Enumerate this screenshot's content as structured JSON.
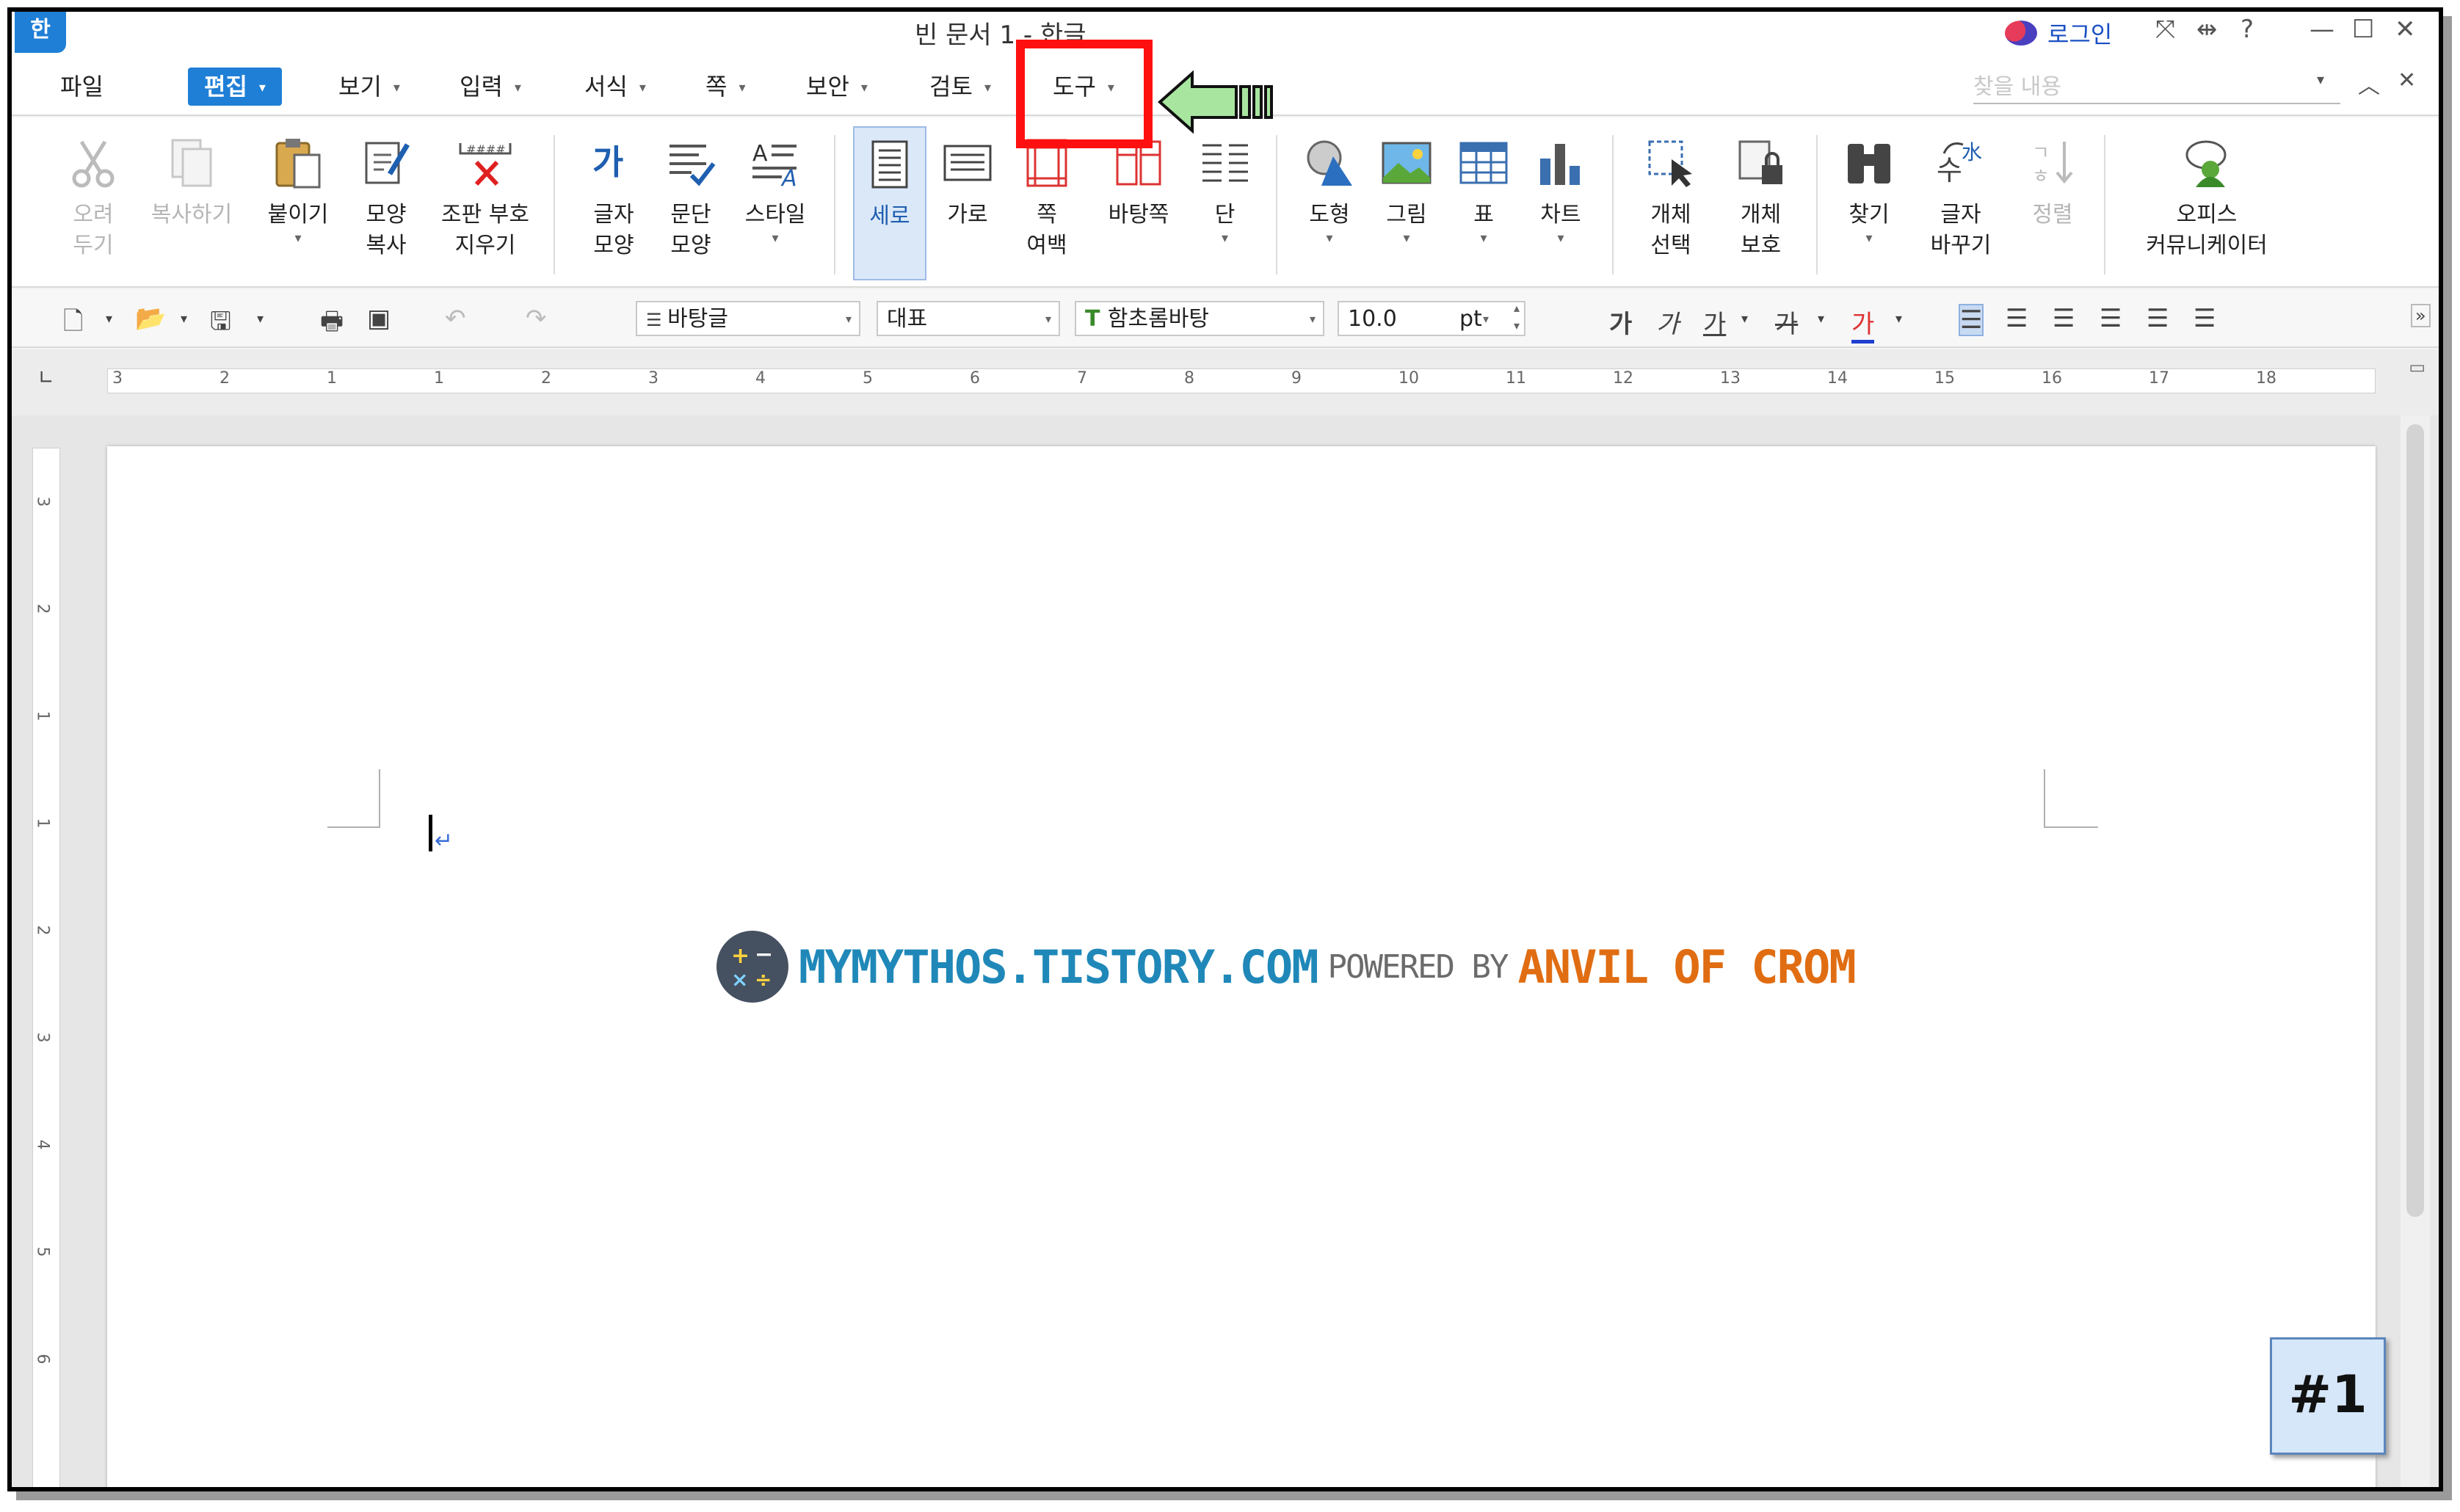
{
  "window": {
    "title": "빈 문서 1 - 한글",
    "app_icon": "한",
    "login_label": "로그인",
    "icons": [
      "fullscreen-icon",
      "pin-icon",
      "help-icon",
      "minimize-icon",
      "maximize-icon",
      "close-icon"
    ]
  },
  "menu": {
    "items": [
      {
        "label": "파일"
      },
      {
        "label": "편집",
        "active": true
      },
      {
        "label": "보기"
      },
      {
        "label": "입력"
      },
      {
        "label": "서식"
      },
      {
        "label": "쪽"
      },
      {
        "label": "보안"
      },
      {
        "label": "검토"
      },
      {
        "label": "도구",
        "highlighted": true
      }
    ],
    "find_placeholder": "찾을 내용"
  },
  "ribbon": {
    "buttons": [
      {
        "label": "오려\n두기",
        "icon": "scissors-icon",
        "disabled": true
      },
      {
        "label": "복사하기",
        "icon": "copy-icon",
        "disabled": true
      },
      {
        "label": "붙이기",
        "icon": "paste-icon"
      },
      {
        "label": "모양\n복사",
        "icon": "format-painter-icon"
      },
      {
        "label": "조판 부호\n지우기",
        "icon": "clear-markup-icon"
      },
      {
        "label": "글자\n모양",
        "icon": "char-shape-icon"
      },
      {
        "label": "문단\n모양",
        "icon": "para-shape-icon"
      },
      {
        "label": "스타일",
        "icon": "style-icon"
      },
      {
        "label": "세로",
        "icon": "portrait-icon",
        "selected": true
      },
      {
        "label": "가로",
        "icon": "landscape-icon"
      },
      {
        "label": "쪽\n여백",
        "icon": "page-margin-icon"
      },
      {
        "label": "바탕쪽",
        "icon": "master-page-icon"
      },
      {
        "label": "단",
        "icon": "columns-icon"
      },
      {
        "label": "도형",
        "icon": "shape-icon"
      },
      {
        "label": "그림",
        "icon": "picture-icon"
      },
      {
        "label": "표",
        "icon": "table-icon"
      },
      {
        "label": "차트",
        "icon": "chart-icon"
      },
      {
        "label": "개체\n선택",
        "icon": "select-object-icon"
      },
      {
        "label": "개체\n보호",
        "icon": "protect-object-icon"
      },
      {
        "label": "찾기",
        "icon": "binoculars-icon"
      },
      {
        "label": "글자\n바꾸기",
        "icon": "replace-char-icon"
      },
      {
        "label": "정렬",
        "icon": "sort-icon",
        "disabled": true
      },
      {
        "label": "오피스\n커뮤니케이터",
        "icon": "communicator-icon"
      }
    ]
  },
  "format_toolbar": {
    "style": "바탕글",
    "language": "대표",
    "font": "함초롬바탕",
    "font_size": "10.0",
    "unit": "pt",
    "char_buttons": [
      "가",
      "가",
      "가",
      "가",
      "가"
    ]
  },
  "ruler": {
    "marks": [
      "3",
      "2",
      "1",
      "1",
      "2",
      "3",
      "4",
      "5",
      "6",
      "7",
      "8",
      "9",
      "10",
      "11",
      "12",
      "13",
      "14",
      "15",
      "16",
      "17",
      "18"
    ],
    "vmarks": [
      "3",
      "2",
      "1",
      "1",
      "2",
      "3",
      "4",
      "5",
      "6"
    ]
  },
  "watermark": {
    "site": "MYMYTHOS.TISTORY.COM",
    "powered": "POWERED BY",
    "brand": "ANVIL OF CROM"
  },
  "badge": {
    "label": "#1"
  },
  "colors": {
    "accent": "#1f7fd6",
    "highlight_box": "#ff1010",
    "arrow_fill": "#a8e6a0",
    "site_blue": "#1f88b8",
    "brand_orange": "#e06d12"
  }
}
